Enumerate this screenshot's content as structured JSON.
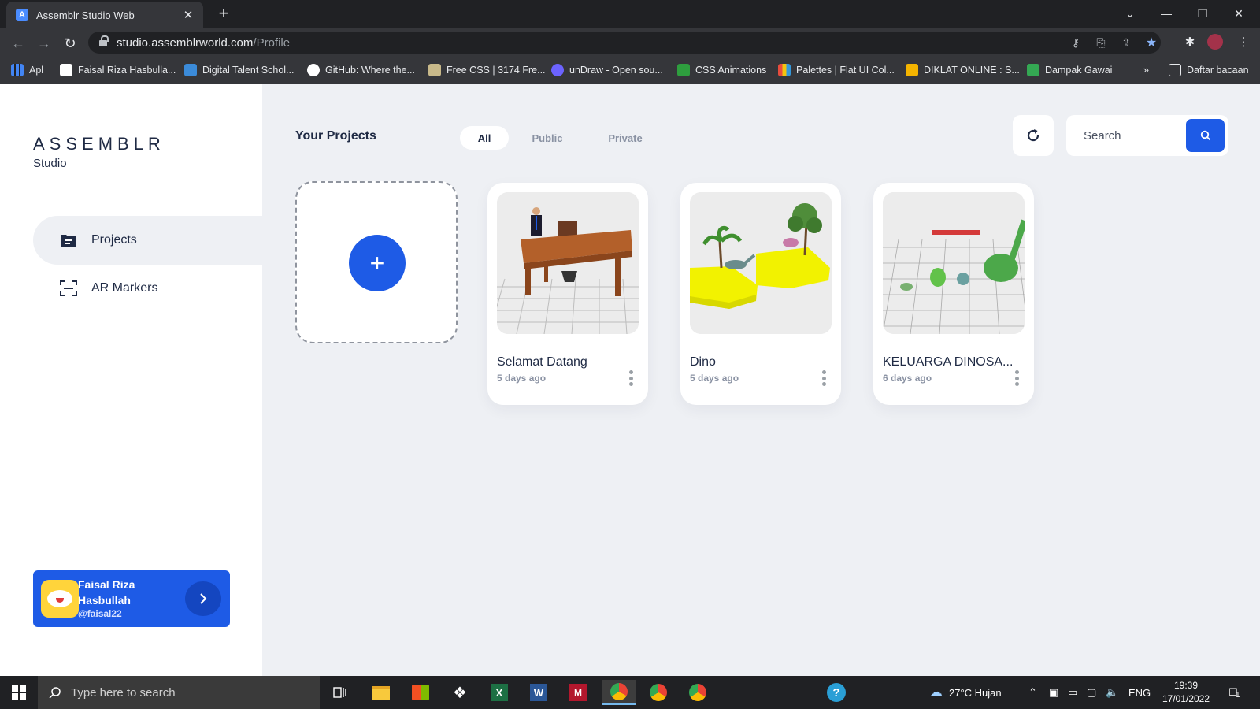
{
  "browser": {
    "tab_title": "Assemblr Studio Web",
    "url_host": "studio.assemblrworld.com",
    "url_path": "/Profile",
    "bookmarks": [
      {
        "label": "Apl",
        "color": "#4285f4"
      },
      {
        "label": "Faisal Riza Hasbulla...",
        "color": "#ffffff"
      },
      {
        "label": "Digital Talent Schol...",
        "color": "#3b8bd9"
      },
      {
        "label": "GitHub: Where the...",
        "color": "#ffffff"
      },
      {
        "label": "Free CSS | 3174 Fre...",
        "color": "#c8b98a"
      },
      {
        "label": "unDraw - Open sou...",
        "color": "#6c63ff"
      },
      {
        "label": "CSS Animations",
        "color": "#2e9e3e"
      },
      {
        "label": "Palettes | Flat UI Col...",
        "color": "#e84c3d"
      },
      {
        "label": "DIKLAT ONLINE : S...",
        "color": "#f4b400"
      },
      {
        "label": "Dampak Gawai",
        "color": "#34a853"
      }
    ],
    "bookmarks_overflow": "»",
    "reading_list": "Daftar bacaan"
  },
  "sidebar": {
    "logo": "ASSEMBLR",
    "logo_sub": "Studio",
    "nav": [
      {
        "label": "Projects",
        "icon": "folder-icon",
        "active": true
      },
      {
        "label": "AR Markers",
        "icon": "scan-icon",
        "active": false
      }
    ],
    "user": {
      "name": "Faisal Riza Hasbullah",
      "handle": "@faisal22"
    }
  },
  "main": {
    "title": "Your Projects",
    "filters": [
      {
        "label": "All",
        "active": true
      },
      {
        "label": "Public",
        "active": false
      },
      {
        "label": "Private",
        "active": false
      }
    ],
    "search_placeholder": "Search",
    "new_project_symbol": "+",
    "projects": [
      {
        "name": "Selamat Datang",
        "date": "5 days ago",
        "thumb": "office-desk-scene"
      },
      {
        "name": "Dino",
        "date": "5 days ago",
        "thumb": "dino-island-scene"
      },
      {
        "name": "KELUARGA DINOSA...",
        "date": "6 days ago",
        "thumb": "dino-family-scene"
      }
    ]
  },
  "taskbar": {
    "search_placeholder": "Type here to search",
    "weather": "27°C  Hujan",
    "language": "ENG",
    "time": "19:39",
    "date": "17/01/2022",
    "notification_count": "1"
  },
  "colors": {
    "accent": "#1e5be6",
    "main_bg": "#eef0f4",
    "chrome_dark": "#202124",
    "text_dark": "#1f2a44"
  }
}
